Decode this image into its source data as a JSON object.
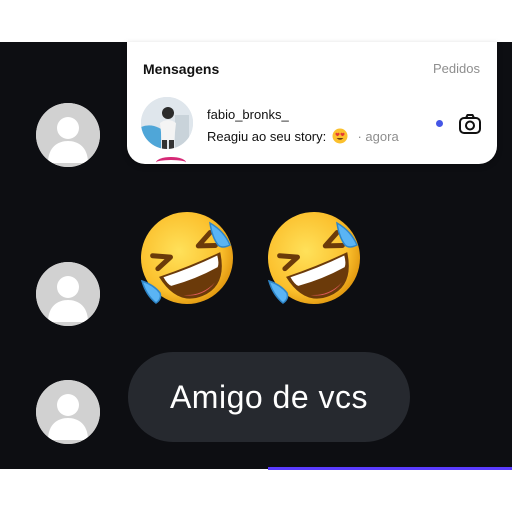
{
  "notification": {
    "title": "Mensagens",
    "action": "Pedidos",
    "username": "fabio_bronks_",
    "message": "Reagiu ao seu story:",
    "reaction_icon": "heart-eyes-emoji",
    "time": "· agora",
    "unread_color": "#4556e6",
    "camera_icon": "camera-icon"
  },
  "chat": {
    "reaction_emoji": "rolling-on-the-floor-laughing",
    "reaction_count": 2,
    "message_bubble": "Amigo de vcs",
    "bubble_color": "#26292f",
    "background": "#0d0e12"
  }
}
